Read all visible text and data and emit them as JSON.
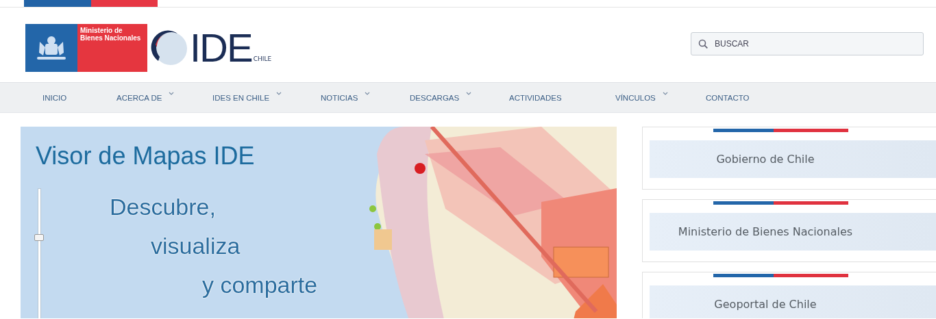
{
  "header": {
    "ministry_logo": "Ministerio de Bienes Nacionales",
    "ide_logo": {
      "name": "IDE",
      "country": "CHILE"
    },
    "search": {
      "placeholder": "BUSCAR"
    }
  },
  "nav": [
    {
      "label": "INICIO",
      "kind": "link"
    },
    {
      "label": "ACERCA DE",
      "kind": "dropdown"
    },
    {
      "label": "IDES EN CHILE",
      "kind": "dropdown"
    },
    {
      "label": "NOTICIAS",
      "kind": "dropdown"
    },
    {
      "label": "DESCARGAS",
      "kind": "dropdown"
    },
    {
      "label": "ACTIVIDADES",
      "kind": "link"
    },
    {
      "label": "VÍNCULOS",
      "kind": "dropdown"
    },
    {
      "label": "CONTACTO",
      "kind": "link"
    }
  ],
  "banner": {
    "title": "Visor de Mapas IDE",
    "slogan": [
      "Descubre,",
      "visualiza",
      "y comparte"
    ],
    "zoom_slider": {
      "level": 0.65
    }
  },
  "links": [
    {
      "label": "Gobierno de Chile"
    },
    {
      "label": "Ministerio de Bienes Nacionales"
    },
    {
      "label": "Geoportal de Chile"
    }
  ]
}
